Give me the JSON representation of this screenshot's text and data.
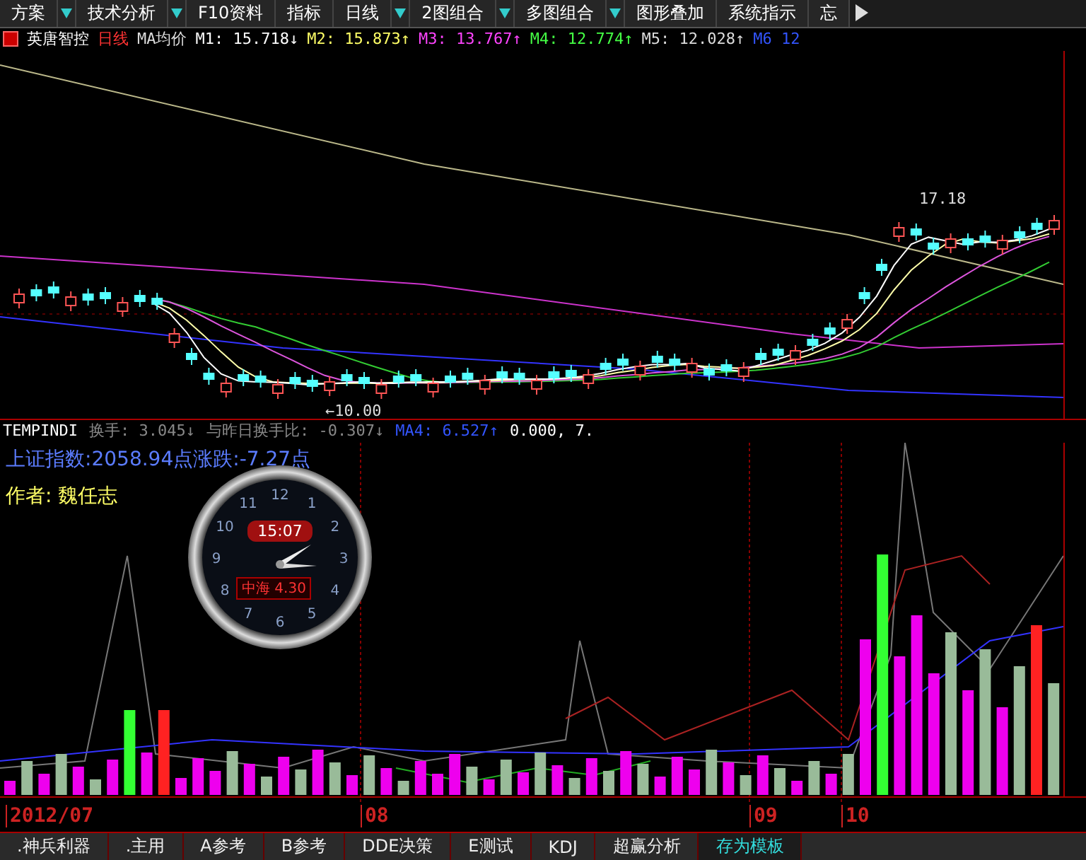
{
  "menu": [
    {
      "label": "方案",
      "dropdown": true
    },
    {
      "label": "技术分析",
      "dropdown": true
    },
    {
      "label": "F10资料",
      "dropdown": false
    },
    {
      "label": "指标",
      "dropdown": false
    },
    {
      "label": "日线",
      "dropdown": true
    },
    {
      "label": "2图组合",
      "dropdown": true
    },
    {
      "label": "多图组合",
      "dropdown": true
    },
    {
      "label": "图形叠加",
      "dropdown": false
    },
    {
      "label": "系统指示",
      "dropdown": false
    },
    {
      "label": "忘",
      "dropdown": false
    }
  ],
  "info_line": {
    "stock": "英唐智控",
    "period": "日线",
    "indicator": "MA均价",
    "averages": [
      {
        "label": "M1:",
        "value": "15.718",
        "arrow": "↓",
        "color": "#ffffff"
      },
      {
        "label": "M2:",
        "value": "15.873",
        "arrow": "↑",
        "color": "#ffff66"
      },
      {
        "label": "M3:",
        "value": "13.767",
        "arrow": "↑",
        "color": "#ff44ff"
      },
      {
        "label": "M4:",
        "value": "12.774",
        "arrow": "↑",
        "color": "#44ff44"
      },
      {
        "label": "M5:",
        "value": "12.028",
        "arrow": "↑",
        "color": "#dddddd"
      },
      {
        "label": "M6",
        "value": "12",
        "color": "#3355ff"
      }
    ]
  },
  "price_chart": {
    "high_label": "17.18",
    "low_label": "←10.00"
  },
  "indicator_line": {
    "name": "TEMPINDI",
    "items": [
      {
        "text": "换手: 3.045",
        "arrow": "↓",
        "color": "#888888"
      },
      {
        "text": "与昨日换手比: -0.307",
        "arrow": "↓",
        "color": "#888888"
      },
      {
        "text": "MA4: 6.527",
        "arrow": "↑",
        "color": "#3355ff"
      },
      {
        "text": "0.000, 7.",
        "color": "#ffffff"
      }
    ]
  },
  "index_text": "上证指数:2058.94点涨跌:-7.27点",
  "author_text": "作者: 魏任志",
  "clock": {
    "time": "15:07",
    "quote": "中海 4.30",
    "numerals": [
      "12",
      "1",
      "2",
      "3",
      "4",
      "5",
      "6",
      "7",
      "8",
      "9",
      "10",
      "11"
    ]
  },
  "date_axis": [
    "2012/07",
    "08",
    "09",
    "10"
  ],
  "bottom_tabs": [
    {
      "label": ".神兵利器",
      "selected": false
    },
    {
      "label": ".主用",
      "selected": false
    },
    {
      "label": "A参考",
      "selected": false
    },
    {
      "label": "B参考",
      "selected": false
    },
    {
      "label": "DDE决策",
      "selected": false
    },
    {
      "label": "E测试",
      "selected": false
    },
    {
      "label": "KDJ",
      "selected": false
    },
    {
      "label": "超赢分析",
      "selected": false
    },
    {
      "label": "存为模板",
      "selected": true
    }
  ]
}
